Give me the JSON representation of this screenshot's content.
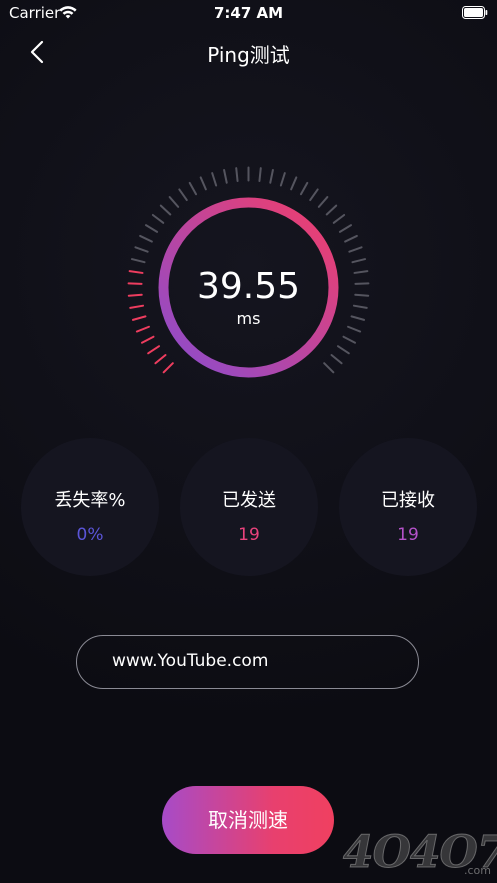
{
  "status_bar": {
    "carrier": "Carrier",
    "time": "7:47 AM"
  },
  "nav": {
    "title": "Ping测试",
    "back_icon": "chevron-left-icon"
  },
  "gauge": {
    "value": "39.55",
    "unit": "ms",
    "progress_fraction": 0.22,
    "ring_gradient": [
      "#f23e6a",
      "#8a4ccf"
    ],
    "active_tick_color": "#ee3d5f",
    "inactive_tick_color": "#55555f"
  },
  "stats": [
    {
      "label": "丢失率%",
      "value": "0%",
      "color": "#5b55d8"
    },
    {
      "label": "已发送",
      "value": "19",
      "color": "#e9427c"
    },
    {
      "label": "已接收",
      "value": "19",
      "color": "#b452c9"
    }
  ],
  "url_field": {
    "value": "www.YouTube.com"
  },
  "cancel_button": {
    "label": "取消测速"
  },
  "watermark": {
    "text": "4O4O7",
    "suffix": ".com"
  }
}
